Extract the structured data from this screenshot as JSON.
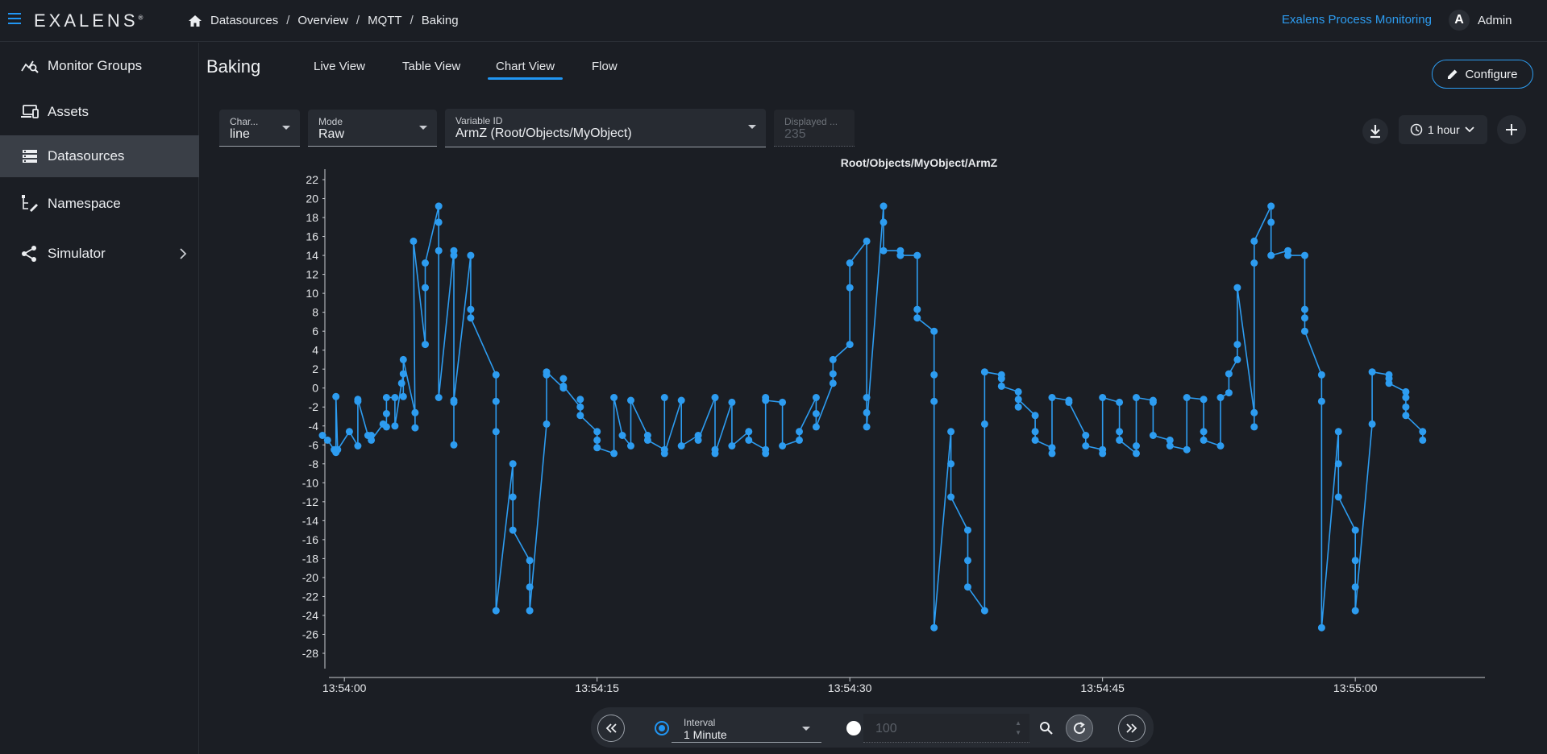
{
  "app": {
    "logo": "EXALENS",
    "logo_mark": "®",
    "app_name": "Exalens Process Monitoring",
    "user_initial": "A",
    "user_name": "Admin"
  },
  "breadcrumbs": [
    "Datasources",
    "Overview",
    "MQTT",
    "Baking"
  ],
  "sidebar": {
    "items": [
      {
        "label": "Monitor Groups",
        "icon": "monitor-groups-icon"
      },
      {
        "label": "Assets",
        "icon": "assets-icon"
      },
      {
        "label": "Datasources",
        "icon": "datasources-icon",
        "active": true
      },
      {
        "label": "Namespace",
        "icon": "namespace-icon"
      },
      {
        "label": "Simulator",
        "icon": "simulator-icon",
        "has_submenu": true
      }
    ]
  },
  "page": {
    "title": "Baking",
    "tabs": [
      {
        "label": "Live View"
      },
      {
        "label": "Table View"
      },
      {
        "label": "Chart View",
        "active": true
      },
      {
        "label": "Flow"
      }
    ],
    "configure_label": "Configure"
  },
  "controls": {
    "chart_type": {
      "label": "Char...",
      "value": "line"
    },
    "mode": {
      "label": "Mode",
      "value": "Raw"
    },
    "variable": {
      "label": "Variable ID",
      "value": "ArmZ (Root/Objects/MyObject)"
    },
    "displayed": {
      "label": "Displayed ...",
      "value": "235"
    },
    "time_range": "1 hour"
  },
  "bottom": {
    "interval_label": "Interval",
    "interval_value": "1 Minute",
    "count_value": "100"
  },
  "colors": {
    "accent": "#2196f3",
    "series": "#2d9cf0",
    "background": "#1b1e24"
  },
  "chart_data": {
    "type": "line",
    "title": "Root/Objects/MyObject/ArmZ",
    "xlabel": "",
    "ylabel": "",
    "ylim": [
      -30,
      23
    ],
    "yticks": [
      22,
      20,
      18,
      16,
      14,
      12,
      10,
      8,
      6,
      4,
      2,
      0,
      -2,
      -4,
      -6,
      -8,
      -10,
      -12,
      -14,
      -16,
      -18,
      -20,
      -22,
      -24,
      -26,
      -28
    ],
    "xlim_seconds": [
      -1.3,
      67.6
    ],
    "xticks": [
      {
        "t": 0,
        "label": "13:54:00"
      },
      {
        "t": 15,
        "label": "13:54:15"
      },
      {
        "t": 30,
        "label": "13:54:30"
      },
      {
        "t": 45,
        "label": "13:54:45"
      },
      {
        "t": 60,
        "label": "13:55:00"
      }
    ],
    "series": [
      {
        "points": [
          [
            -1.3,
            -5
          ],
          [
            -1.0,
            -5.5
          ],
          [
            -0.6,
            -6.5
          ],
          [
            -0.4,
            -6.5
          ],
          [
            -0.5,
            -0.9
          ],
          [
            -0.5,
            -6.8
          ],
          [
            0.3,
            -4.6
          ],
          [
            0.8,
            -6.1
          ],
          [
            0.8,
            -1.4
          ],
          [
            0.8,
            -1.2
          ],
          [
            1.4,
            -5
          ],
          [
            1.6,
            -5
          ],
          [
            1.6,
            -5.5
          ],
          [
            2.3,
            -3.8
          ],
          [
            2.5,
            -4.1
          ],
          [
            2.5,
            -2.7
          ],
          [
            2.5,
            -1
          ],
          [
            3.0,
            -1
          ],
          [
            3.0,
            -4
          ],
          [
            3.4,
            0.5
          ],
          [
            3.5,
            1.5
          ],
          [
            3.5,
            -0.9
          ],
          [
            3.5,
            3
          ],
          [
            4.2,
            -2.6
          ],
          [
            4.2,
            -4.2
          ],
          [
            4.1,
            15.5
          ],
          [
            4.8,
            4.6
          ],
          [
            4.8,
            10.6
          ],
          [
            4.8,
            13.2
          ],
          [
            5.6,
            19.2
          ],
          [
            5.6,
            17.5
          ],
          [
            5.6,
            14.5
          ],
          [
            5.6,
            -1
          ],
          [
            6.5,
            14.5
          ],
          [
            6.5,
            14
          ],
          [
            6.5,
            -6
          ],
          [
            6.5,
            -1.5
          ],
          [
            6.5,
            -1.3
          ],
          [
            7.5,
            14
          ],
          [
            7.5,
            8.3
          ],
          [
            7.5,
            7.4
          ],
          [
            9.0,
            1.4
          ],
          [
            9.0,
            -1.4
          ],
          [
            9.0,
            -4.6
          ],
          [
            9.0,
            -23.5
          ],
          [
            10.0,
            -8
          ],
          [
            10.0,
            -11.5
          ],
          [
            10.0,
            -15
          ],
          [
            11.0,
            -18.2
          ],
          [
            11.0,
            -21
          ],
          [
            11.0,
            -23.5
          ],
          [
            12.0,
            -3.8
          ],
          [
            12.0,
            1.4
          ],
          [
            12.0,
            1.7
          ],
          [
            13.0,
            0
          ],
          [
            13.0,
            1
          ],
          [
            13.0,
            0.2
          ],
          [
            14.0,
            -2
          ],
          [
            14.0,
            -1.2
          ],
          [
            14.0,
            -2.9
          ],
          [
            15.0,
            -4.6
          ],
          [
            15.0,
            -5.5
          ],
          [
            15.0,
            -6.3
          ],
          [
            16.0,
            -6.9
          ],
          [
            16.0,
            -1
          ],
          [
            16.5,
            -5
          ],
          [
            17.0,
            -6.1
          ],
          [
            17.0,
            -1.3
          ],
          [
            18.0,
            -5
          ],
          [
            18.0,
            -5.5
          ],
          [
            19.0,
            -6.5
          ],
          [
            19.0,
            -1
          ],
          [
            19.0,
            -6.9
          ],
          [
            20.0,
            -1.3
          ],
          [
            20.0,
            -6.1
          ],
          [
            21.0,
            -5
          ],
          [
            21.0,
            -5.5
          ],
          [
            22.0,
            -1
          ],
          [
            22.0,
            -6.5
          ],
          [
            22.0,
            -6.9
          ],
          [
            23.0,
            -1.5
          ],
          [
            23.0,
            -6.1
          ],
          [
            24.0,
            -4.6
          ],
          [
            24.0,
            -5.5
          ],
          [
            25.0,
            -6.5
          ],
          [
            25.0,
            -6.9
          ],
          [
            25.0,
            -1
          ],
          [
            25.0,
            -1.3
          ],
          [
            26.0,
            -1.5
          ],
          [
            26.0,
            -6.1
          ],
          [
            27.0,
            -5.5
          ],
          [
            27.0,
            -4.6
          ],
          [
            28.0,
            -1
          ],
          [
            28.0,
            -2.7
          ],
          [
            28.0,
            -4.1
          ],
          [
            29.0,
            0.5
          ],
          [
            29.0,
            1.5
          ],
          [
            29.0,
            3
          ],
          [
            30.0,
            4.6
          ],
          [
            30.0,
            10.6
          ],
          [
            30.0,
            13.2
          ],
          [
            31.0,
            15.5
          ],
          [
            31.0,
            -1
          ],
          [
            31.0,
            -2.6
          ],
          [
            31.0,
            -4.1
          ],
          [
            32.0,
            19.2
          ],
          [
            32.0,
            17.5
          ],
          [
            32.0,
            14.5
          ],
          [
            33.0,
            14.5
          ],
          [
            33.0,
            14
          ],
          [
            34.0,
            14
          ],
          [
            34.0,
            8.3
          ],
          [
            34.0,
            7.4
          ],
          [
            35.0,
            6
          ],
          [
            35.0,
            1.4
          ],
          [
            35.0,
            -1.4
          ],
          [
            35.0,
            -25.3
          ],
          [
            36.0,
            -4.6
          ],
          [
            36.0,
            -8
          ],
          [
            36.0,
            -11.5
          ],
          [
            37.0,
            -15
          ],
          [
            37.0,
            -18.2
          ],
          [
            37.0,
            -21
          ],
          [
            38.0,
            -23.5
          ],
          [
            38.0,
            -3.8
          ],
          [
            38.0,
            1.7
          ],
          [
            39.0,
            1.4
          ],
          [
            39.0,
            1
          ],
          [
            39.0,
            0.2
          ],
          [
            40.0,
            -0.4
          ],
          [
            40.0,
            -2
          ],
          [
            40.0,
            -1.2
          ],
          [
            41.0,
            -2.9
          ],
          [
            41.0,
            -4.6
          ],
          [
            41.0,
            -5.5
          ],
          [
            42.0,
            -6.3
          ],
          [
            42.0,
            -6.9
          ],
          [
            42.0,
            -1
          ],
          [
            43.0,
            -1.3
          ],
          [
            43.0,
            -1.5
          ],
          [
            44.0,
            -5
          ],
          [
            44.0,
            -6.1
          ],
          [
            45.0,
            -6.5
          ],
          [
            45.0,
            -6.9
          ],
          [
            45.0,
            -1
          ],
          [
            46.0,
            -1.5
          ],
          [
            46.0,
            -4.6
          ],
          [
            46.0,
            -5.5
          ],
          [
            47.0,
            -6.9
          ],
          [
            47.0,
            -6.1
          ],
          [
            47.0,
            -1
          ],
          [
            48.0,
            -1.3
          ],
          [
            48.0,
            -1.5
          ],
          [
            48.0,
            -5
          ],
          [
            49.0,
            -5.5
          ],
          [
            49.0,
            -6.1
          ],
          [
            50.0,
            -6.5
          ],
          [
            50.0,
            -1
          ],
          [
            51.0,
            -1.2
          ],
          [
            51.0,
            -4.6
          ],
          [
            51.0,
            -5.5
          ],
          [
            52.0,
            -6.1
          ],
          [
            52.0,
            -1
          ],
          [
            52.5,
            -0.5
          ],
          [
            52.5,
            1.5
          ],
          [
            53.0,
            3
          ],
          [
            53.0,
            4.6
          ],
          [
            53.0,
            10.6
          ],
          [
            54.0,
            -2.6
          ],
          [
            54.0,
            -4.1
          ],
          [
            54.0,
            13.2
          ],
          [
            54.0,
            15.5
          ],
          [
            55.0,
            19.2
          ],
          [
            55.0,
            17.5
          ],
          [
            55.0,
            14
          ],
          [
            56.0,
            14.5
          ],
          [
            56.0,
            14
          ],
          [
            57.0,
            14
          ],
          [
            57.0,
            8.3
          ],
          [
            57.0,
            7.4
          ],
          [
            57.0,
            6
          ],
          [
            58.0,
            1.4
          ],
          [
            58.0,
            -1.4
          ],
          [
            58.0,
            -25.3
          ],
          [
            59.0,
            -4.6
          ],
          [
            59.0,
            -8
          ],
          [
            59.0,
            -11.5
          ],
          [
            60.0,
            -15
          ],
          [
            60.0,
            -18.2
          ],
          [
            60.0,
            -21
          ],
          [
            60.0,
            -23.5
          ],
          [
            61.0,
            -3.8
          ],
          [
            61.0,
            1.7
          ],
          [
            62.0,
            1.4
          ],
          [
            62.0,
            1
          ],
          [
            62.0,
            0.5
          ],
          [
            63.0,
            -0.4
          ],
          [
            63.0,
            -1
          ],
          [
            63.0,
            -2
          ],
          [
            63.0,
            -2.9
          ],
          [
            64.0,
            -4.6
          ],
          [
            64.0,
            -5.5
          ]
        ]
      }
    ],
    "grid": false,
    "legend": "none"
  }
}
